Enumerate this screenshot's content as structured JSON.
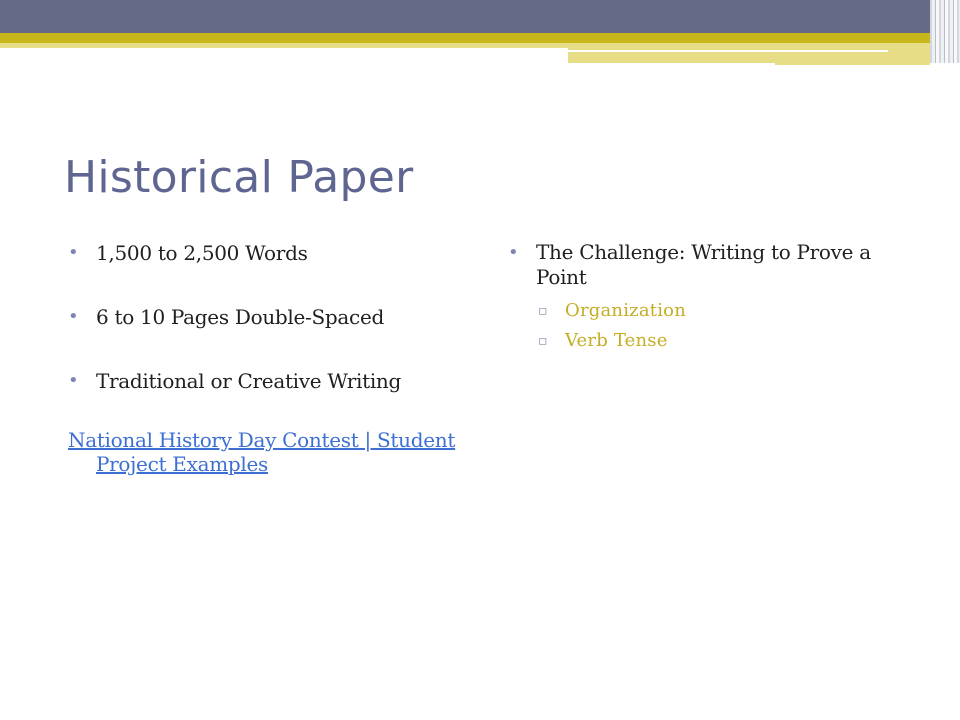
{
  "slide": {
    "title": "Historical Paper",
    "left_bullets": [
      "1,500 to 2,500 Words",
      "6 to 10 Pages Double-Spaced",
      "Traditional or Creative Writing"
    ],
    "link_text": "National History Day Contest | Student Project Examples",
    "right_bullet": "The Challenge: Writing to Prove a Point",
    "sub_bullets": [
      "Organization",
      "Verb Tense"
    ]
  },
  "icons": {
    "bullet": "bullet-dot-icon",
    "sub_bullet": "square-bullet-icon"
  },
  "colors": {
    "header_slate": "#646b86",
    "header_gold": "#c8b71c",
    "title": "#5f6591",
    "link": "#3d6fd2",
    "sub_bullet_text": "#c4ad23"
  }
}
